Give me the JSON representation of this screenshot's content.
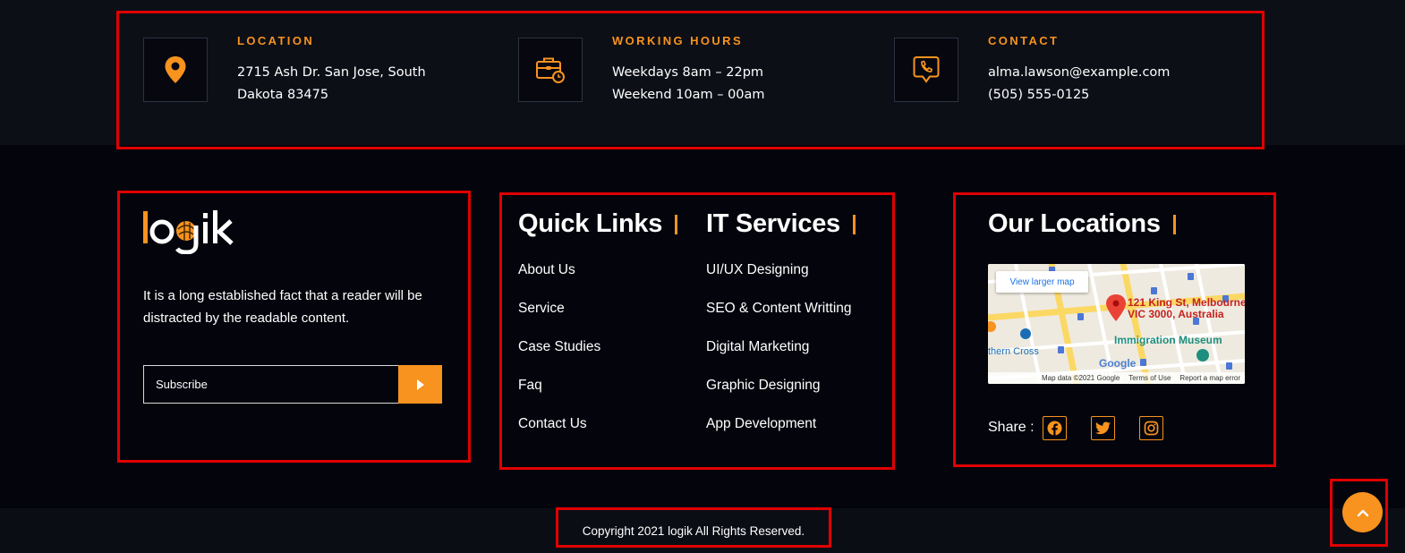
{
  "info": {
    "location": {
      "icon": "location-pin-icon",
      "title": "LOCATION",
      "lines": [
        "2715 Ash Dr. San Jose, South",
        "Dakota 83475"
      ]
    },
    "hours": {
      "icon": "briefcase-clock-icon",
      "title": "WORKING HOURS",
      "lines": [
        "Weekdays 8am – 22pm",
        "Weekend 10am – 00am"
      ]
    },
    "contact": {
      "icon": "phone-chat-icon",
      "title": "CONTACT",
      "lines": [
        "alma.lawson@example.com",
        "(505) 555-0125"
      ]
    }
  },
  "brand": {
    "logo_text": "logik",
    "about": "It is a long established fact that a reader will be distracted by the readable content.",
    "subscribe_placeholder": "Subscribe",
    "subscribe_icon": "caret-right-icon"
  },
  "quick_links": {
    "heading": "Quick Links",
    "items": [
      "About Us",
      "Service",
      "Case Studies",
      "Faq",
      "Contact Us"
    ]
  },
  "it_services": {
    "heading": "IT Services",
    "items": [
      "UI/UX Designing",
      "SEO & Content Writting",
      "Digital Marketing",
      "Graphic Designing",
      "App Development"
    ]
  },
  "locations": {
    "heading": "Our Locations",
    "map": {
      "view_larger": "View larger map",
      "address_line1": "121 King St, Melbourne",
      "address_line2": "VIC 3000, Australia",
      "poi": "Immigration Museum",
      "station": "thern Cross",
      "google": "Google",
      "map_data": "Map data ©2021 Google",
      "terms": "Terms of Use",
      "report": "Report a map error"
    },
    "share_label": "Share :",
    "socials": [
      "facebook-icon",
      "twitter-icon",
      "instagram-icon"
    ]
  },
  "copyright": "Copyright 2021 logik All Rights Reserved.",
  "back_to_top_icon": "chevron-up-icon",
  "colors": {
    "accent": "#f7931e",
    "background": "#03040c",
    "band": "#0d0f17",
    "highlight": "#e00000"
  }
}
